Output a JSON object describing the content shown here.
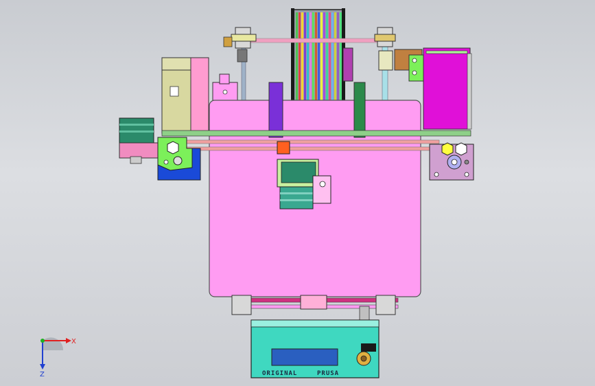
{
  "scene": {
    "lcd_brand_left": "ORIGINAL",
    "lcd_brand_right": "PRUSA"
  },
  "triad": {
    "x_label": "X",
    "z_label": "Z"
  },
  "colors": {
    "frame": "#ff9cf2",
    "lcd_panel": "#3fd8c0",
    "lcd_screen": "#2a5fc0",
    "left_bracket": "#7cf05a",
    "blue_block": "#1a4ad8",
    "extruder": "#2b8a7a",
    "spool_edge": "#2a2a2a",
    "magenta_box": "#e010d8",
    "axis_x": "#e02020",
    "axis_y": "#20b020",
    "axis_z": "#2040d0"
  },
  "icons": [
    "axis-triad-icon",
    "prusa-knob-icon"
  ]
}
